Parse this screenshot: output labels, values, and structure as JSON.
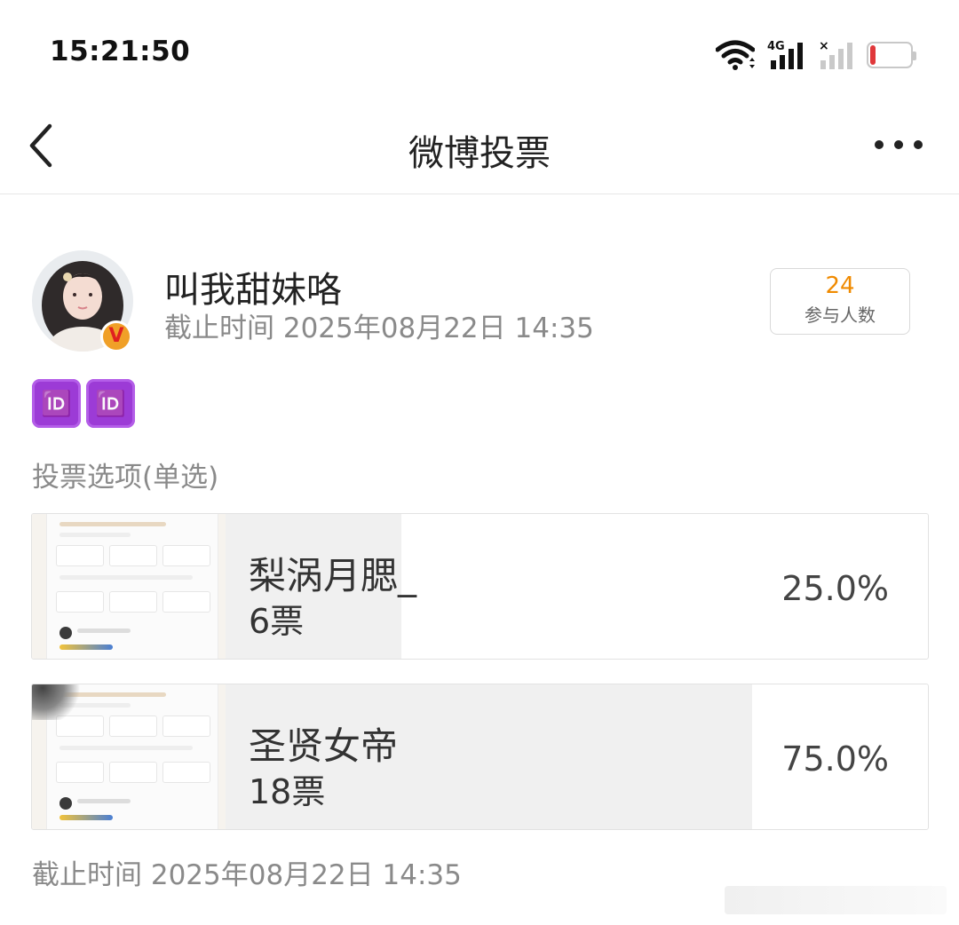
{
  "status_bar": {
    "time": "15:21:50",
    "network": "4G",
    "battery": "16",
    "icons": [
      "wifi-icon",
      "signal-4g-icon",
      "signal-no-service-icon",
      "battery-icon"
    ]
  },
  "nav": {
    "title": "微博投票",
    "back_icon": "chevron-left-icon",
    "more_icon": "more-dots-icon"
  },
  "poll": {
    "author": "叫我甜妹咯",
    "verified_badge": "V",
    "deadline": "截止时间 2025年08月22日 14:35",
    "participants": {
      "count": "24",
      "label": "参与人数"
    },
    "emoji": [
      "🆔",
      "🆔"
    ],
    "section_label": "投票选项(单选)",
    "options": [
      {
        "name": "梨涡月腮_",
        "votes": "6票",
        "percent": "25.0%",
        "share": 0.25
      },
      {
        "name": "圣贤女帝",
        "votes": "18票",
        "percent": "75.0%",
        "share": 0.75
      }
    ],
    "footer_deadline": "截止时间 2025年08月22日 14:35"
  },
  "colors": {
    "accent_orange": "#f08a00",
    "badge_purple": "#9c3bd6",
    "battery_red": "#e0383b",
    "fill_gray": "#f0f0f0"
  }
}
